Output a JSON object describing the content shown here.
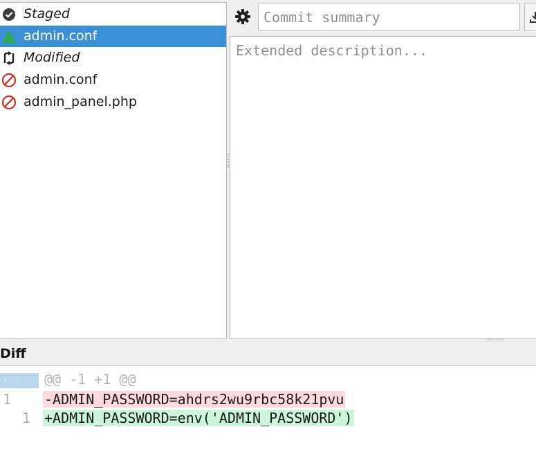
{
  "status_tree": {
    "items": [
      {
        "label": "Staged",
        "icon": "check-circle-icon",
        "header": true
      },
      {
        "label": "admin.conf",
        "icon": "triangle-up-icon",
        "selected": true
      },
      {
        "label": "Modified",
        "icon": "modified-arrows-icon",
        "header": true
      },
      {
        "label": "admin.conf",
        "icon": "prohibited-icon"
      },
      {
        "label": "admin_panel.php",
        "icon": "prohibited-icon"
      }
    ]
  },
  "commit": {
    "summary_placeholder": "Commit summary",
    "description_placeholder": "Extended description..."
  },
  "diff": {
    "title": "Diff",
    "hunk_header": "@@ -1 +1 @@",
    "hunk_gutter": "· ·",
    "lines": [
      {
        "old": "1",
        "new": "",
        "text": "-ADMIN_PASSWORD=ahdrs2wu9rbc58k21pvu",
        "kind": "del"
      },
      {
        "old": "",
        "new": "1",
        "text": "+ADMIN_PASSWORD=env('ADMIN_PASSWORD')",
        "kind": "add"
      }
    ]
  },
  "colors": {
    "selection": "#3b8fd5",
    "staged_icon": "#2eaa4e",
    "prohibited_icon": "#d62b2b",
    "diff_deleted": "#fbd9dd",
    "diff_added": "#ccf5d9",
    "hunk_gutter": "#b9d8ef"
  }
}
